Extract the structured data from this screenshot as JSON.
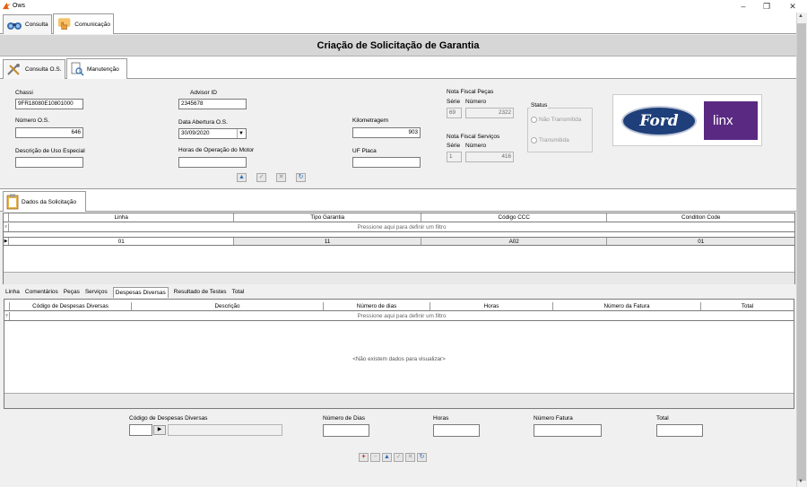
{
  "window": {
    "title": "Ows",
    "minimize": "–",
    "maximize": "❐",
    "close": "✕"
  },
  "main_tabs": [
    {
      "label": "Consulta"
    },
    {
      "label": "Comunicação"
    }
  ],
  "header": {
    "title": "Criação de Solicitação de Garantia"
  },
  "sub_tabs": [
    {
      "label": "Consulta O.S."
    },
    {
      "label": "Manutenção"
    }
  ],
  "form": {
    "chassi_label": "Chassi",
    "chassi_value": "9FR18080E10801000",
    "advisor_label": "Advisor ID",
    "advisor_value": "2345678",
    "numero_os_label": "Número O.S.",
    "numero_os_value": "646",
    "data_abertura_label": "Data Abertura O.S.",
    "data_abertura_value": "30/09/2020",
    "descricao_uso_label": "Descrição de Uso Especial",
    "descricao_uso_value": "",
    "horas_motor_label": "Horas de Operação do Motor",
    "horas_motor_value": "",
    "km_label": "Kilometragem",
    "km_value": "903",
    "uf_label": "UF Placa",
    "uf_value": "",
    "nf_pecas_label": "Nota Fiscal Peças",
    "nf_serv_label": "Nota Fiscal Serviços",
    "serie_label": "Série",
    "numero_label": "Número",
    "nf_pecas_serie": "69",
    "nf_pecas_numero": "2322",
    "nf_serv_serie": "1",
    "nf_serv_numero": "416",
    "status_label": "Status",
    "status_opt1": "Não Transmitida",
    "status_opt2": "Transmitida"
  },
  "logos": {
    "brand1": "Ford",
    "brand2": "linx"
  },
  "section_tab": {
    "label": "Dados da Solicitação"
  },
  "grid1": {
    "columns": [
      "Linha",
      "Tipo Garantia",
      "Código CCC",
      "Condition Code"
    ],
    "filter": "Pressione aqui para definir um filtro",
    "rows": [
      [
        "01",
        "11",
        "A02",
        "01"
      ]
    ]
  },
  "bottom_tabs": [
    "Linha",
    "Comentários",
    "Peças",
    "Serviços",
    "Despesas Diversas",
    "Resultado de Testes",
    "Total"
  ],
  "grid2": {
    "columns": [
      "Código de Despesas Diversas",
      "Descrição",
      "Número de dias",
      "Horas",
      "Número da Fatura",
      "Total"
    ],
    "filter": "Pressione aqui para definir um filtro",
    "empty": "<Não existem dados para visualizar>"
  },
  "bottom_form": {
    "cod_label": "Código de Despesas Diversas",
    "dias_label": "Número de Dias",
    "horas_label": "Horas",
    "fatura_label": "Número Fatura",
    "total_label": "Total"
  },
  "colors": {
    "accent": "#2a6db5",
    "ford_blue": "#1f3f7a",
    "linx_purple": "#5a2a82"
  }
}
